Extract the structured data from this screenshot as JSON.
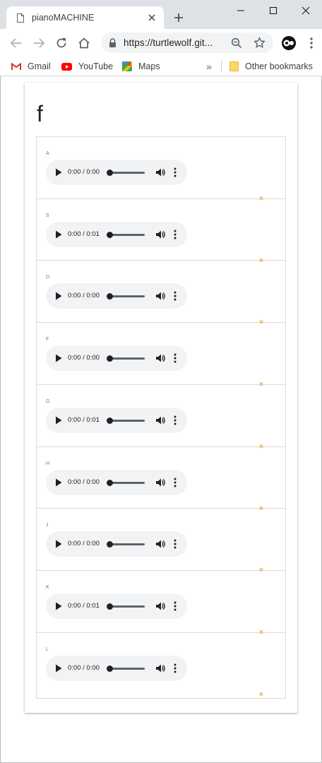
{
  "browser": {
    "tab_title": "pianoMACHINE",
    "url": "https://turtlewolf.git...",
    "bookmarks": [
      {
        "label": "Gmail",
        "icon": "gmail-icon"
      },
      {
        "label": "YouTube",
        "icon": "youtube-icon"
      },
      {
        "label": "Maps",
        "icon": "maps-icon"
      }
    ],
    "overflow": "»",
    "other_bookmarks": "Other bookmarks"
  },
  "page": {
    "title": "f",
    "remove_symbol": "×",
    "keys": [
      {
        "label": "A",
        "time": "0:00 / 0:00"
      },
      {
        "label": "S",
        "time": "0:00 / 0:01"
      },
      {
        "label": "D",
        "time": "0:00 / 0:00"
      },
      {
        "label": "F",
        "time": "0:00 / 0:00"
      },
      {
        "label": "G",
        "time": "0:00 / 0:01"
      },
      {
        "label": "H",
        "time": "0:00 / 0:00"
      },
      {
        "label": "J",
        "time": "0:00 / 0:00"
      },
      {
        "label": "K",
        "time": "0:00 / 0:01"
      },
      {
        "label": "L",
        "time": "0:00 / 0:00"
      }
    ]
  },
  "colors": {
    "remove_accent": "#f0a13a",
    "chrome_bg": "#dee1e6",
    "player_bg": "#f1f3f4"
  }
}
